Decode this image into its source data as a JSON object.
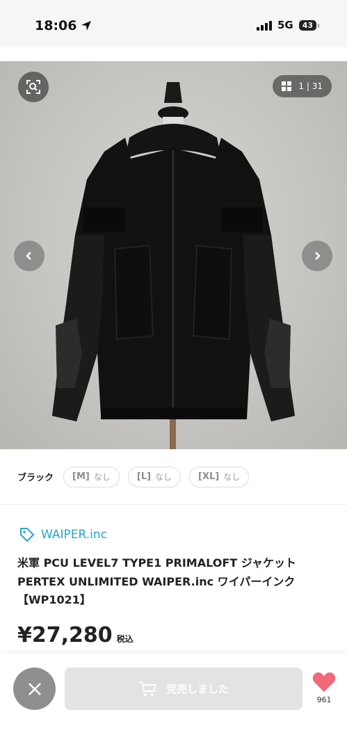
{
  "status_bar": {
    "time": "18:06",
    "network": "5G",
    "battery": "43"
  },
  "gallery": {
    "counter": "1 | 31"
  },
  "variants": {
    "color": "ブラック",
    "sizes": [
      {
        "name": "[M]",
        "stock": "なし"
      },
      {
        "name": "[L]",
        "stock": "なし"
      },
      {
        "name": "[XL]",
        "stock": "なし"
      }
    ]
  },
  "product": {
    "shop_name": "WAIPER.inc",
    "title_line1": "米軍 PCU LEVEL7 TYPE1 PRIMALOFT ジャケット",
    "title_line2": "PERTEX UNLIMITED WAIPER.inc ワイパーインク",
    "title_line3": "【WP1021】",
    "price": "¥27,280",
    "tax_label": "税込"
  },
  "actions": {
    "soldout_label": "完売しました",
    "like_count": "961"
  },
  "colors": {
    "accent": "#2aa5c9",
    "heart": "#f06a7c"
  }
}
